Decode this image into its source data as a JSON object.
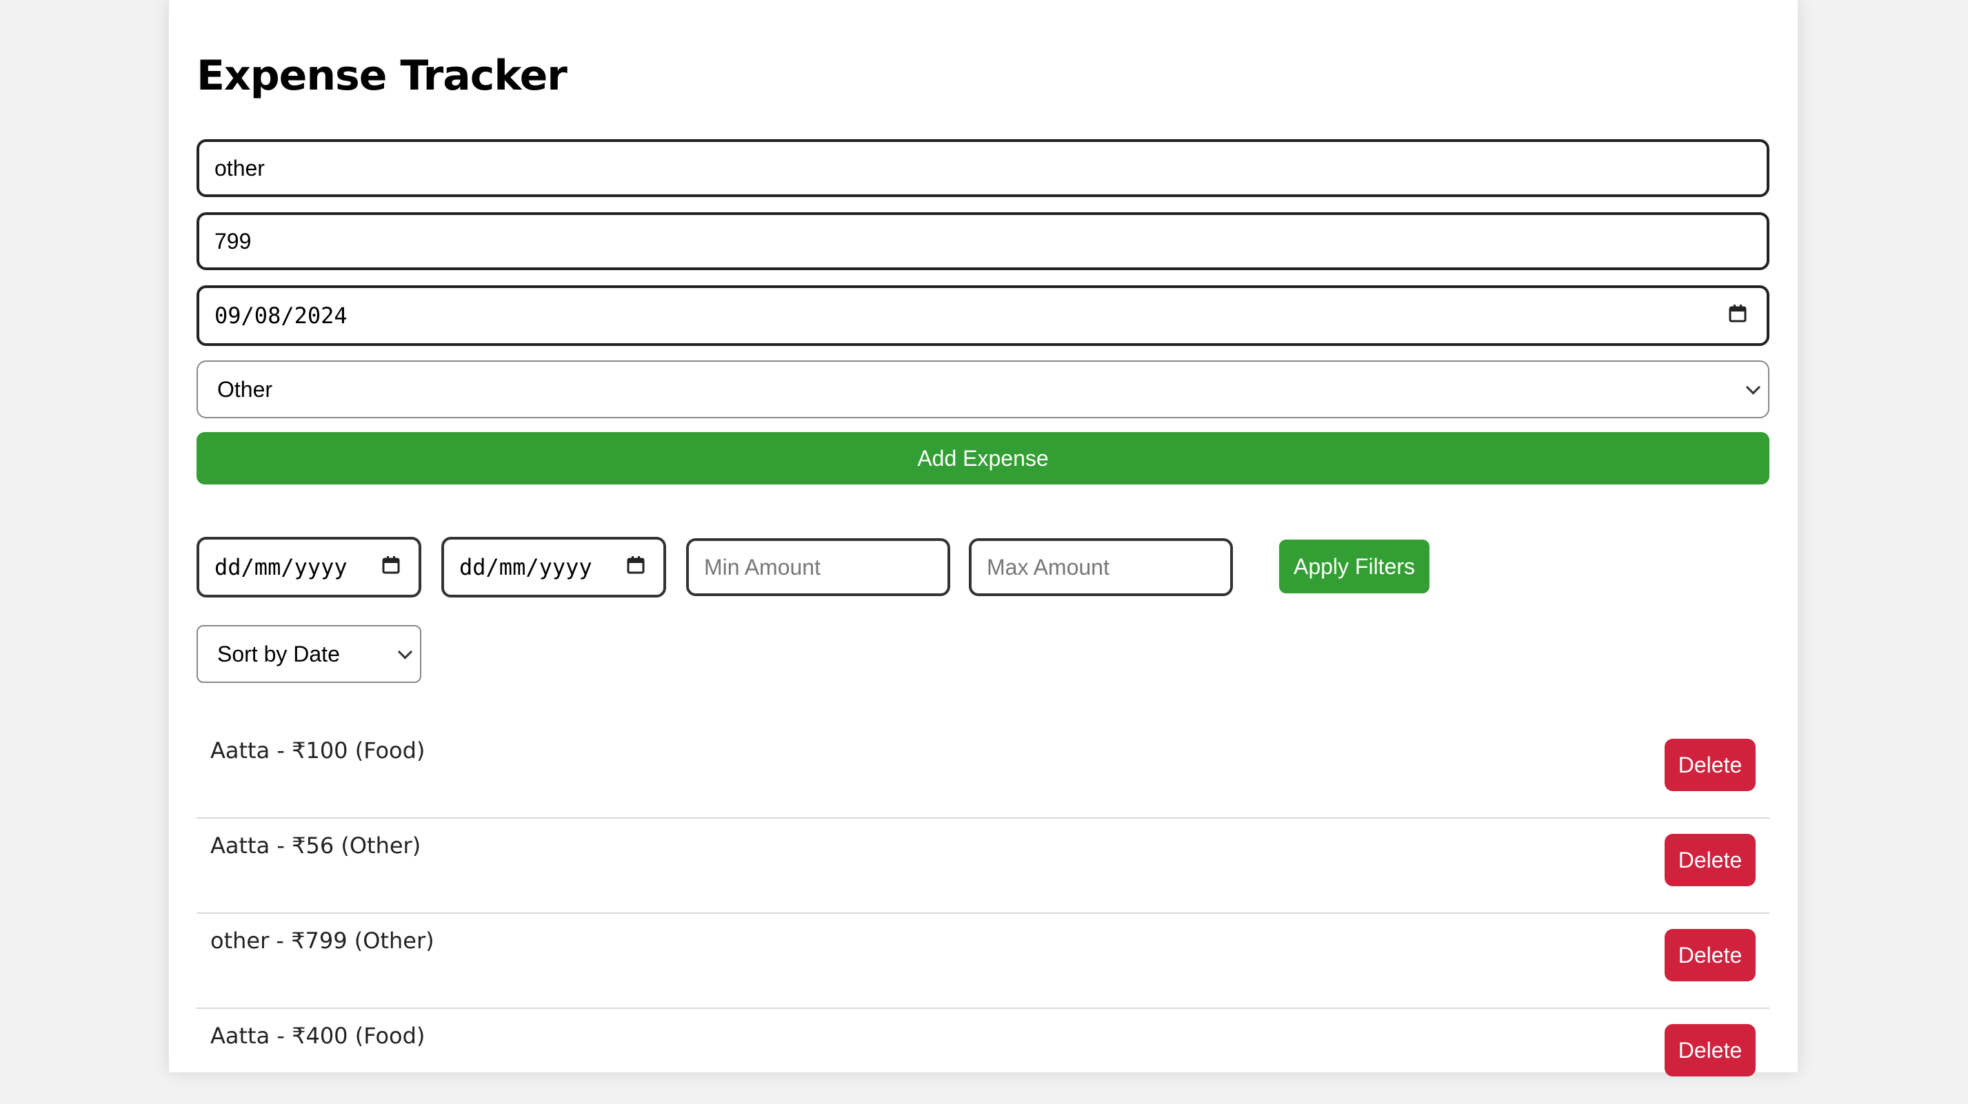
{
  "app": {
    "title": "Expense Tracker"
  },
  "form": {
    "description_value": "other",
    "amount_value": "799",
    "date_value": "09/08/2024",
    "category_selected": "Other",
    "add_label": "Add Expense"
  },
  "filters": {
    "start_date_placeholder": "dd/mm/yyyy",
    "end_date_placeholder": "dd/mm/yyyy",
    "min_amount_placeholder": "Min Amount",
    "max_amount_placeholder": "Max Amount",
    "apply_label": "Apply Filters",
    "sort_selected": "Sort by Date"
  },
  "expenses": [
    {
      "text": "Aatta - ₹100 (Food)",
      "delete_label": "Delete"
    },
    {
      "text": "Aatta - ₹56 (Other)",
      "delete_label": "Delete"
    },
    {
      "text": "other - ₹799 (Other)",
      "delete_label": "Delete"
    },
    {
      "text": "Aatta - ₹400 (Food)",
      "delete_label": "Delete"
    }
  ],
  "colors": {
    "primary_green": "#339e33",
    "delete_red": "#d0213d"
  },
  "icons": {
    "date_picker": "calendar-icon",
    "select": "chevron-down-icon"
  }
}
